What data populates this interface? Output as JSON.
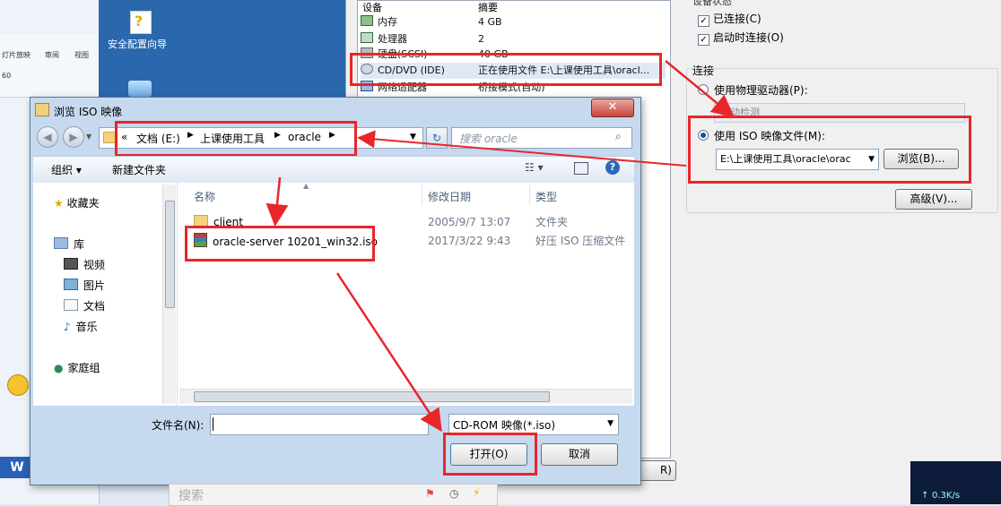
{
  "background": {
    "word_ribbon": {
      "tabs": [
        "灯片放映",
        "审阅",
        "视图"
      ],
      "font_size": "60"
    },
    "desktop": {
      "wizard_label": "安全配置向导"
    },
    "bottom_search": {
      "placeholder": "搜索"
    }
  },
  "vm_settings": {
    "device_header": {
      "col_device": "设备",
      "col_summary": "摘要"
    },
    "devices": [
      {
        "name": "内存",
        "summary": "4 GB",
        "icon": "memory-icon"
      },
      {
        "name": "处理器",
        "summary": "2",
        "icon": "cpu-icon"
      },
      {
        "name": "硬盘(SCSI)",
        "summary": "40 GB",
        "icon": "disk-icon"
      },
      {
        "name": "CD/DVD (IDE)",
        "summary": "正在使用文件 E:\\上课使用工具\\oracl...",
        "icon": "cd-icon"
      },
      {
        "name": "网络适配器",
        "summary": "桥接模式(自动)",
        "icon": "network-icon"
      }
    ],
    "device_status": {
      "title": "设备状态",
      "connected": {
        "label": "已连接(C)",
        "checked": true
      },
      "connect_on_start": {
        "label": "启动时连接(O)",
        "checked": true
      }
    },
    "connection": {
      "title": "连接",
      "physical_drive": {
        "label": "使用物理驱动器(P):",
        "selected": false,
        "value": "自动检测"
      },
      "iso_image": {
        "label": "使用 ISO 映像文件(M):",
        "selected": true,
        "value": "E:\\上课使用工具\\oracle\\orac"
      },
      "browse_button": "浏览(B)...",
      "advanced_button": "高级(V)..."
    },
    "partial_button": "R)"
  },
  "dialog": {
    "title": "浏览 ISO 映像",
    "breadcrumb": [
      "«",
      "文档 (E:)",
      "上课使用工具",
      "oracle"
    ],
    "search_placeholder": "搜索 oracle",
    "toolbar": {
      "organize": "组织 ▾",
      "new_folder": "新建文件夹"
    },
    "nav": {
      "favorites": "收藏夹",
      "library": "库",
      "video": "视频",
      "pictures": "图片",
      "documents": "文档",
      "music": "音乐",
      "homegroup": "家庭组"
    },
    "columns": {
      "name": "名称",
      "modified": "修改日期",
      "type": "类型"
    },
    "files": [
      {
        "name": "client",
        "modified": "2005/9/7 13:07",
        "type": "文件夹",
        "icon": "folder-icon"
      },
      {
        "name": "oracle-server 10201_win32.iso",
        "modified": "2017/3/22 9:43",
        "type": "好压 ISO 压缩文件",
        "icon": "archive-icon"
      }
    ],
    "filename_label": "文件名(N):",
    "filename_value": "",
    "filetype_value": "CD-ROM 映像(*.iso)",
    "open_button": "打开(O)",
    "cancel_button": "取消"
  },
  "tray": {
    "net_speed": "0.3K/s"
  },
  "colors": {
    "annotation_red": "#e8262a",
    "desktop_blue": "#2b67ad"
  }
}
